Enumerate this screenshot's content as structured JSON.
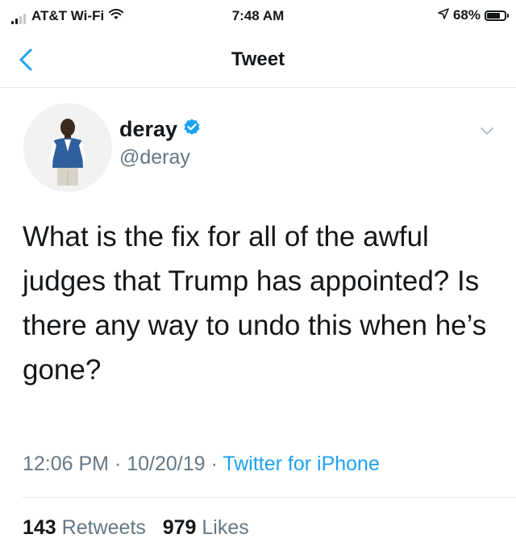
{
  "status_bar": {
    "carrier": "AT&T Wi-Fi",
    "time": "7:48 AM",
    "battery_percent": "68%",
    "battery_level": 0.68,
    "signal_bars": 2,
    "signal_total": 4
  },
  "nav": {
    "title": "Tweet",
    "back_icon": "chevron-left-icon",
    "accent_color": "#1da1f2"
  },
  "author": {
    "name": "deray",
    "handle": "@deray",
    "verified": true,
    "verified_icon": "verified-badge-icon"
  },
  "tweet": {
    "text": "What is the fix for all of the awful judges that Trump has appointed? Is there any way to undo this when he’s gone?",
    "time": "12:06 PM",
    "date": "10/20/19",
    "separator": " · ",
    "source": "Twitter for iPhone"
  },
  "stats": {
    "retweets_count": "143",
    "retweets_label": "Retweets",
    "likes_count": "979",
    "likes_label": "Likes"
  },
  "colors": {
    "text_primary": "#14171a",
    "text_secondary": "#657786",
    "link": "#1da1f2",
    "divider": "#e1e8ed"
  }
}
